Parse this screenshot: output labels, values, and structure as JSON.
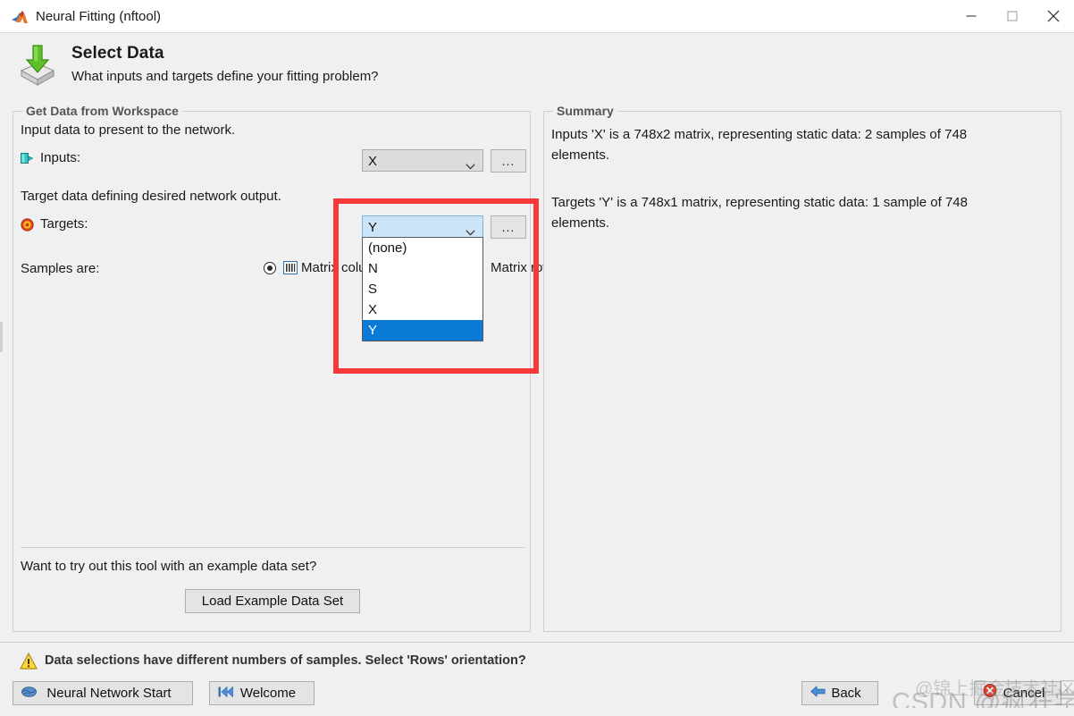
{
  "window": {
    "title": "Neural Fitting (nftool)",
    "logo_icon": "matlab-logo-icon",
    "minimize_icon": "minimize-icon",
    "maximize_icon": "maximize-icon",
    "close_icon": "close-icon"
  },
  "header": {
    "icon": "import-data-icon",
    "title": "Select Data",
    "subtitle": "What inputs and targets define your fitting problem?"
  },
  "left_panel": {
    "group_title": "Get Data from Workspace",
    "inputs": {
      "description": "Input data to present to the network.",
      "label": "Inputs:",
      "icon": "inputs-port-icon",
      "value": "X",
      "browse_label": "...",
      "arrow_icon": "chevron-down-icon"
    },
    "targets": {
      "description": "Target data defining desired network output.",
      "label": "Targets:",
      "icon": "targets-bullseye-icon",
      "value": "Y",
      "browse_label": "...",
      "arrow_icon": "chevron-down-icon",
      "dropdown_open": true,
      "options": [
        "(none)",
        "N",
        "S",
        "X",
        "Y"
      ],
      "selected_option": "Y"
    },
    "samples": {
      "label": "Samples are:",
      "matrix_columns_text": "Matrix columns",
      "matrix_rows_text": "Matrix rows",
      "columns_icon": "matrix-columns-icon",
      "selected": "Matrix columns"
    },
    "example": {
      "question": "Want to try out this tool with an example data set?",
      "button_label": "Load Example Data Set"
    }
  },
  "right_panel": {
    "group_title": "Summary",
    "inputs_summary": "Inputs 'X' is a 748x2 matrix, representing static data: 2 samples of 748 elements.",
    "targets_summary": "Targets 'Y' is a 748x1 matrix, representing static data: 1 sample of 748 elements."
  },
  "annotation": {
    "name": "red-highlight-box",
    "color": "#f7373a"
  },
  "status_bar": {
    "warning_icon": "warning-triangle-icon",
    "warning_text": "Data selections have different numbers of samples. Select 'Rows' orientation?",
    "neural_network_start": {
      "label": "Neural Network Start",
      "icon": "brain-icon"
    },
    "welcome": {
      "label": "Welcome",
      "icon": "rewind-start-icon"
    },
    "back": {
      "label": "Back",
      "icon": "back-arrow-icon"
    },
    "cancel": {
      "label": "Cancel",
      "icon": "cancel-icon"
    }
  },
  "watermark": {
    "main_text": "CSDN @疯狂学习jcls",
    "overlay_text": "@锦上掘金技术社区"
  }
}
